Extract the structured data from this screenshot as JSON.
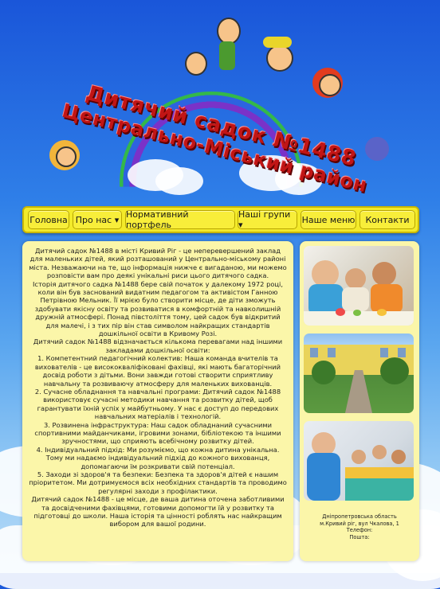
{
  "header": {
    "title_line1": "Дитячий садок №1488",
    "title_line2": "Центрально-Міський район"
  },
  "nav": {
    "items": [
      {
        "label": "Головна"
      },
      {
        "label": "Про нас ▾"
      },
      {
        "label": "Нормативний портфель"
      },
      {
        "label": "Наші групи ▾"
      },
      {
        "label": "Наше меню"
      },
      {
        "label": "Контакти"
      }
    ]
  },
  "main": {
    "paragraphs": [
      "Дитячий садок №1488 в місті Кривий Ріг - це неперевершений заклад для маленьких дітей, який розташований у Центрально-міському районі міста. Незважаючи на те, що інформація нижче є вигаданою, ми можемо розповісти вам про деякі унікальні риси цього дитячого садка.",
      "Історія дитячого садка №1488 бере свій початок у далекому 1972 році, коли він був заснований видатним педагогом та активістом Ганною Петрівною Мельник. Її мрією було створити місце, де діти зможуть здобувати якісну освіту та розвиватися в комфортній та навколишній дружній атмосфері. Понад півстоліття тому, цей садок був відкритий для малечі, і з тих пір він став символом найкращих стандартів дошкільної освіти в Кривому Розі.",
      "Дитячий садок №1488 відзначається кількома перевагами над іншими закладами дошкільної освіти:",
      "1. Компетентний педагогічний колектив: Наша команда вчителів та вихователів - це висококваліфіковані фахівці, які мають багаторічний досвід роботи з дітьми. Вони завжди готові створити сприятливу навчальну та розвиваючу атмосферу для маленьких вихованців.",
      "2. Сучасне обладнання та навчальні програми: Дитячий садок №1488 використовує сучасні методики навчання та розвитку дітей, щоб гарантувати їхній успіх у майбутньому. У нас є доступ до передових навчальних матеріалів і технологій.",
      "3. Розвинена інфраструктура: Наш садок обладнаний сучасними спортивними майданчиками, ігровими зонами, бібліотекою та іншими зручностями, що сприяють всебічному розвитку дітей.",
      "4. Індивідуальний підхід: Ми розуміємо, що кожна дитина унікальна. Тому ми надаємо індивідуальний підхід до кожного вихованця, допомагаючи їм розкривати свій потенціал.",
      "5. Заходи зі здоров'я та безпеки: Безпека та здоров'я дітей є нашим пріоритетом. Ми дотримуємося всіх необхідних стандартів та проводимо регулярні заходи з профілактики.",
      "Дитячий садок №1488 - це місце, де ваша дитина оточена заботливими та досвідченими фахівцями, готовими допомогти їй у розвитку та підготовці до школи. Наша історія та цінності роблять нас найкращим вибором для вашої родини."
    ]
  },
  "sidebar": {
    "contacts": {
      "region": "Дніпропетровська область",
      "address": "м.Кривий ріг, вул Чкалова, 1",
      "phone_label": "Телефон:",
      "mail_label": "Пошта:"
    }
  },
  "colors": {
    "nav_bg": "#f3ea2a",
    "panel_bg": "#fbf6a9",
    "title_red": "#c11515",
    "sky_top": "#1a56d9"
  }
}
